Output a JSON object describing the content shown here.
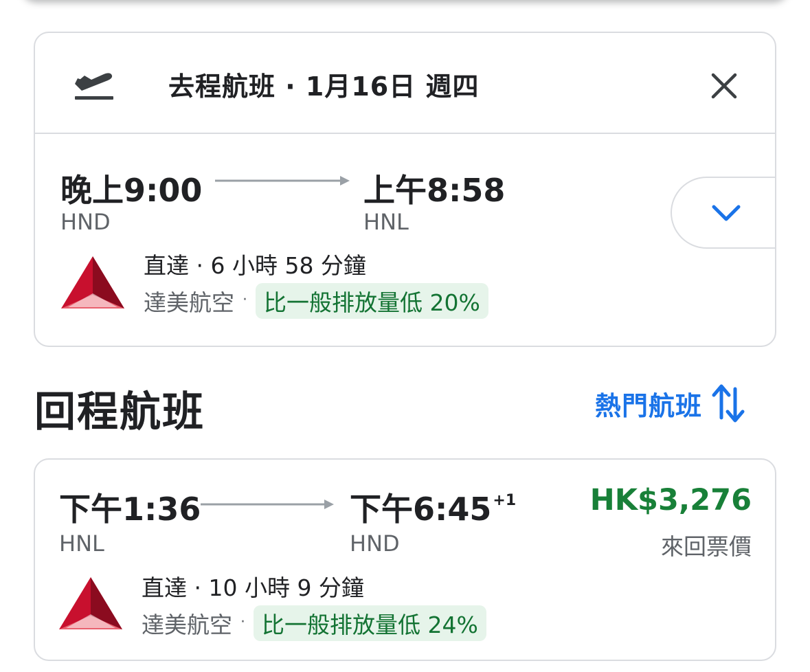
{
  "outbound": {
    "header_title": "去程航班 · 1月16日 週四",
    "depart_time": "晚上9:00",
    "depart_airport": "HND",
    "arrive_time": "上午8:58",
    "arrive_airport": "HNL",
    "stops_duration": "直達 · 6 小時 58 分鐘",
    "airline": "達美航空",
    "separator": "·",
    "emissions": "比一般排放量低 20%"
  },
  "return_section": {
    "title": "回程航班",
    "sort_label": "熱門航班"
  },
  "return_flight": {
    "depart_time": "下午1:36",
    "depart_airport": "HNL",
    "arrive_time": "下午6:45",
    "arrive_day_offset": "+1",
    "arrive_airport": "HND",
    "stops_duration": "直達 · 10 小時 9 分鐘",
    "airline": "達美航空",
    "separator": "·",
    "emissions": "比一般排放量低 24%",
    "price": "HK$3,276",
    "price_label": "來回票價"
  },
  "icons": {
    "header": "flight-takeoff-icon",
    "close": "close-icon",
    "expand": "chevron-down-icon",
    "sort": "swap-vert-icon",
    "airline_logo": "delta-logo"
  },
  "colors": {
    "accent_blue": "#1a73e8",
    "price_green": "#188038",
    "eco_bg": "#e6f4ea",
    "eco_text": "#137333",
    "delta_red": "#c8102e"
  }
}
